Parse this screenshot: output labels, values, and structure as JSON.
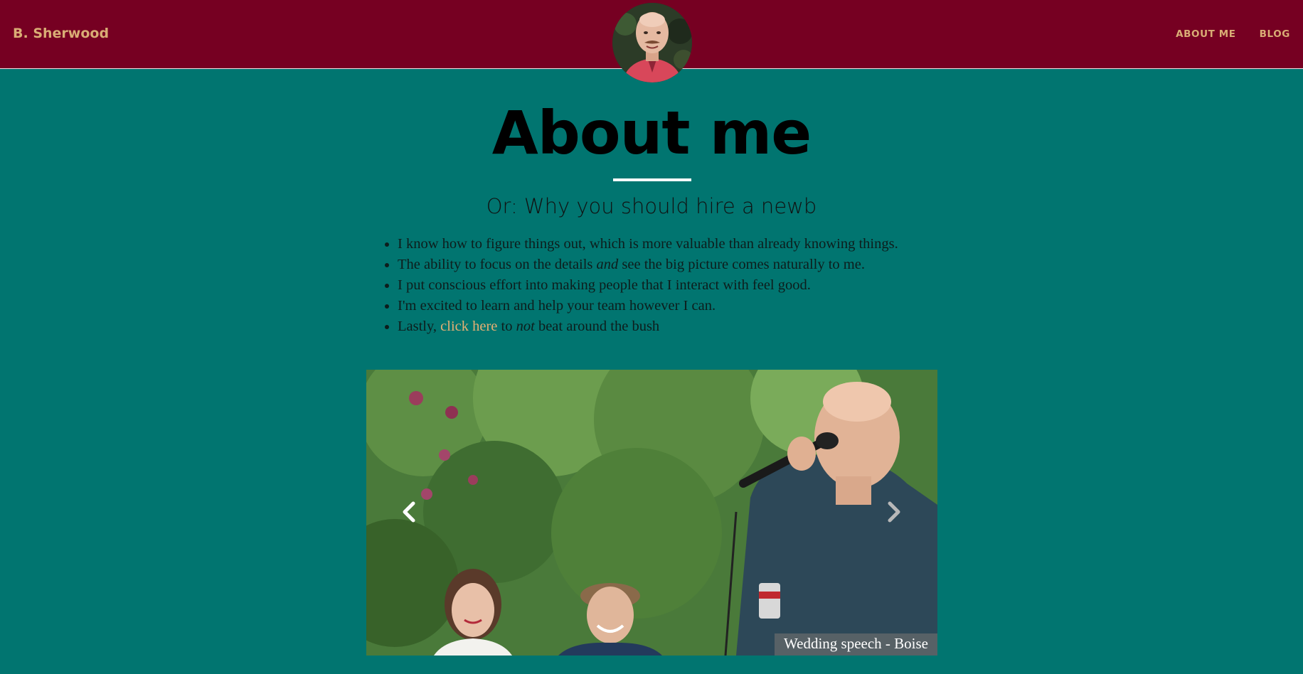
{
  "navbar": {
    "brand": "B. Sherwood",
    "links": [
      {
        "label": "ABOUT ME"
      },
      {
        "label": "BLOG"
      }
    ],
    "colors": {
      "background": "#760022",
      "link": "#d9ad75"
    }
  },
  "header": {
    "title": "About me",
    "subtitle": "Or: Why you should hire a newb"
  },
  "reasons": {
    "item1": "I know how to figure things out, which is more valuable than already knowing things.",
    "item2_before": "The ability to focus on the details ",
    "item2_em": "and",
    "item2_after": " see the big picture comes naturally to me.",
    "item3": "I put conscious effort into making people that I interact with feel good.",
    "item4": "I'm excited to learn and help your team however I can.",
    "item5_before": "Lastly, ",
    "item5_link": "click here",
    "item5_middle": " to ",
    "item5_em": "not",
    "item5_after": " beat around the bush"
  },
  "carousel": {
    "caption": "Wedding speech - Boise",
    "prev_icon": "chevron-left-icon",
    "next_icon": "chevron-right-icon"
  },
  "colors": {
    "page_background": "#017570",
    "accent_link": "#e7b073"
  }
}
